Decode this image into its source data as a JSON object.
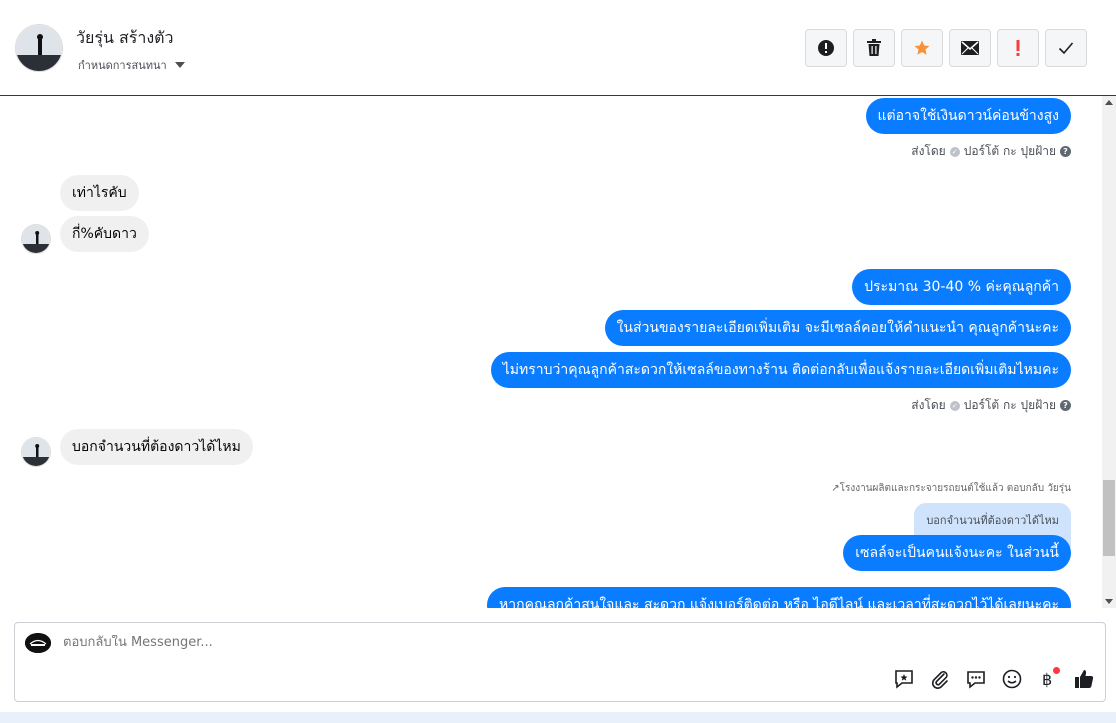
{
  "header": {
    "contact_name": "วัยรุ่น สร้างตัว",
    "conversation_settings": "กำหนดการสนทนา",
    "actions": [
      {
        "name": "report-button",
        "icon": "alert-circle-icon"
      },
      {
        "name": "delete-button",
        "icon": "trash-icon"
      },
      {
        "name": "star-button",
        "icon": "star-icon"
      },
      {
        "name": "mark-unread-button",
        "icon": "envelope-icon"
      },
      {
        "name": "follow-up-button",
        "icon": "exclamation-icon"
      },
      {
        "name": "mark-done-button",
        "icon": "checkmark-icon"
      }
    ]
  },
  "messages": {
    "m1": "แต่อาจใช้เงินดาวน์ค่อนข้างสูง",
    "sent_by_1": "ส่งโดย",
    "sender_1": "ปอร์โต้ กะ ปุยฝ้าย",
    "m2": "เท่าไรคับ",
    "m3": "กี่%คับดาว",
    "m4": "ประมาณ 30-40 % ค่ะคุณลูกค้า",
    "m5": "ในส่วนของรายละเอียดเพิ่มเติม จะมีเซลล์คอยให้คำแนะนำ คุณลูกค้านะคะ",
    "m6": "ไม่ทราบว่าคุณลูกค้าสะดวกให้เซลล์ของทางร้าน ติดต่อกลับเพื่อแจ้งรายละเอียดเพิ่มเติมไหมคะ",
    "sent_by_2": "ส่งโดย",
    "sender_2": "ปอร์โต้ กะ ปุยฝ้าย",
    "m7": "บอกจำนวนที่ต้องดาวได้ไหม",
    "reply_note": "โรงงานผลิตและกระจายรถยนต์ใช้แล้ว ตอบกลับ วัยรุ่น",
    "quoted": "บอกจำนวนที่ต้องดาวได้ไหม",
    "m8": "เซลล์จะเป็นคนแจ้งนะคะ ในส่วนนี้",
    "m9": "หากคุณลูกค้าสนใจและ สะดวก แจ้งเบอร์ติดต่อ หรือ ไอดีไลน์ และเวลาที่สะดวกไว้ได้เลยนะคะ"
  },
  "composer": {
    "placeholder": "ตอบกลับใน Messenger...",
    "tools": [
      "saved-reply-icon",
      "attachment-icon",
      "chat-bubble-icon",
      "emoji-icon",
      "baht-payment-icon",
      "thumbs-up-icon"
    ]
  },
  "colors": {
    "outgoing_bubble": "#0a7cff",
    "incoming_bubble": "#f0f0f0",
    "star": "#f7923b",
    "alert": "#fa3e3e"
  }
}
